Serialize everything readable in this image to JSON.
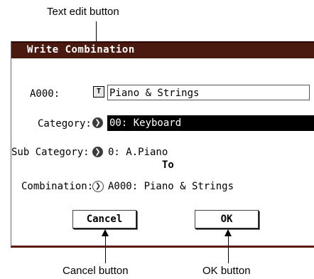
{
  "callouts": {
    "text_edit": "Text edit button",
    "cancel": "Cancel button",
    "ok": "OK button"
  },
  "dialog": {
    "title": "Write Combination",
    "name_label": "A000:",
    "text_edit_glyph": "T",
    "name_value": "Piano & Strings",
    "category_label": "Category:",
    "category_value": "00: Keyboard",
    "subcategory_label": "Sub Category:",
    "subcategory_value": "0: A.Piano",
    "to_label": "To",
    "combination_label": "Combination:",
    "combination_value": "A000: Piano & Strings",
    "cancel_label": "Cancel",
    "ok_label": "OK"
  },
  "icons": {
    "popup": "popup-arrow-icon",
    "text_edit": "text-edit-icon"
  },
  "colors": {
    "titlebar": "#4a1a10",
    "field_bg": "#000000",
    "bottom_border": "#5a1a0f"
  }
}
